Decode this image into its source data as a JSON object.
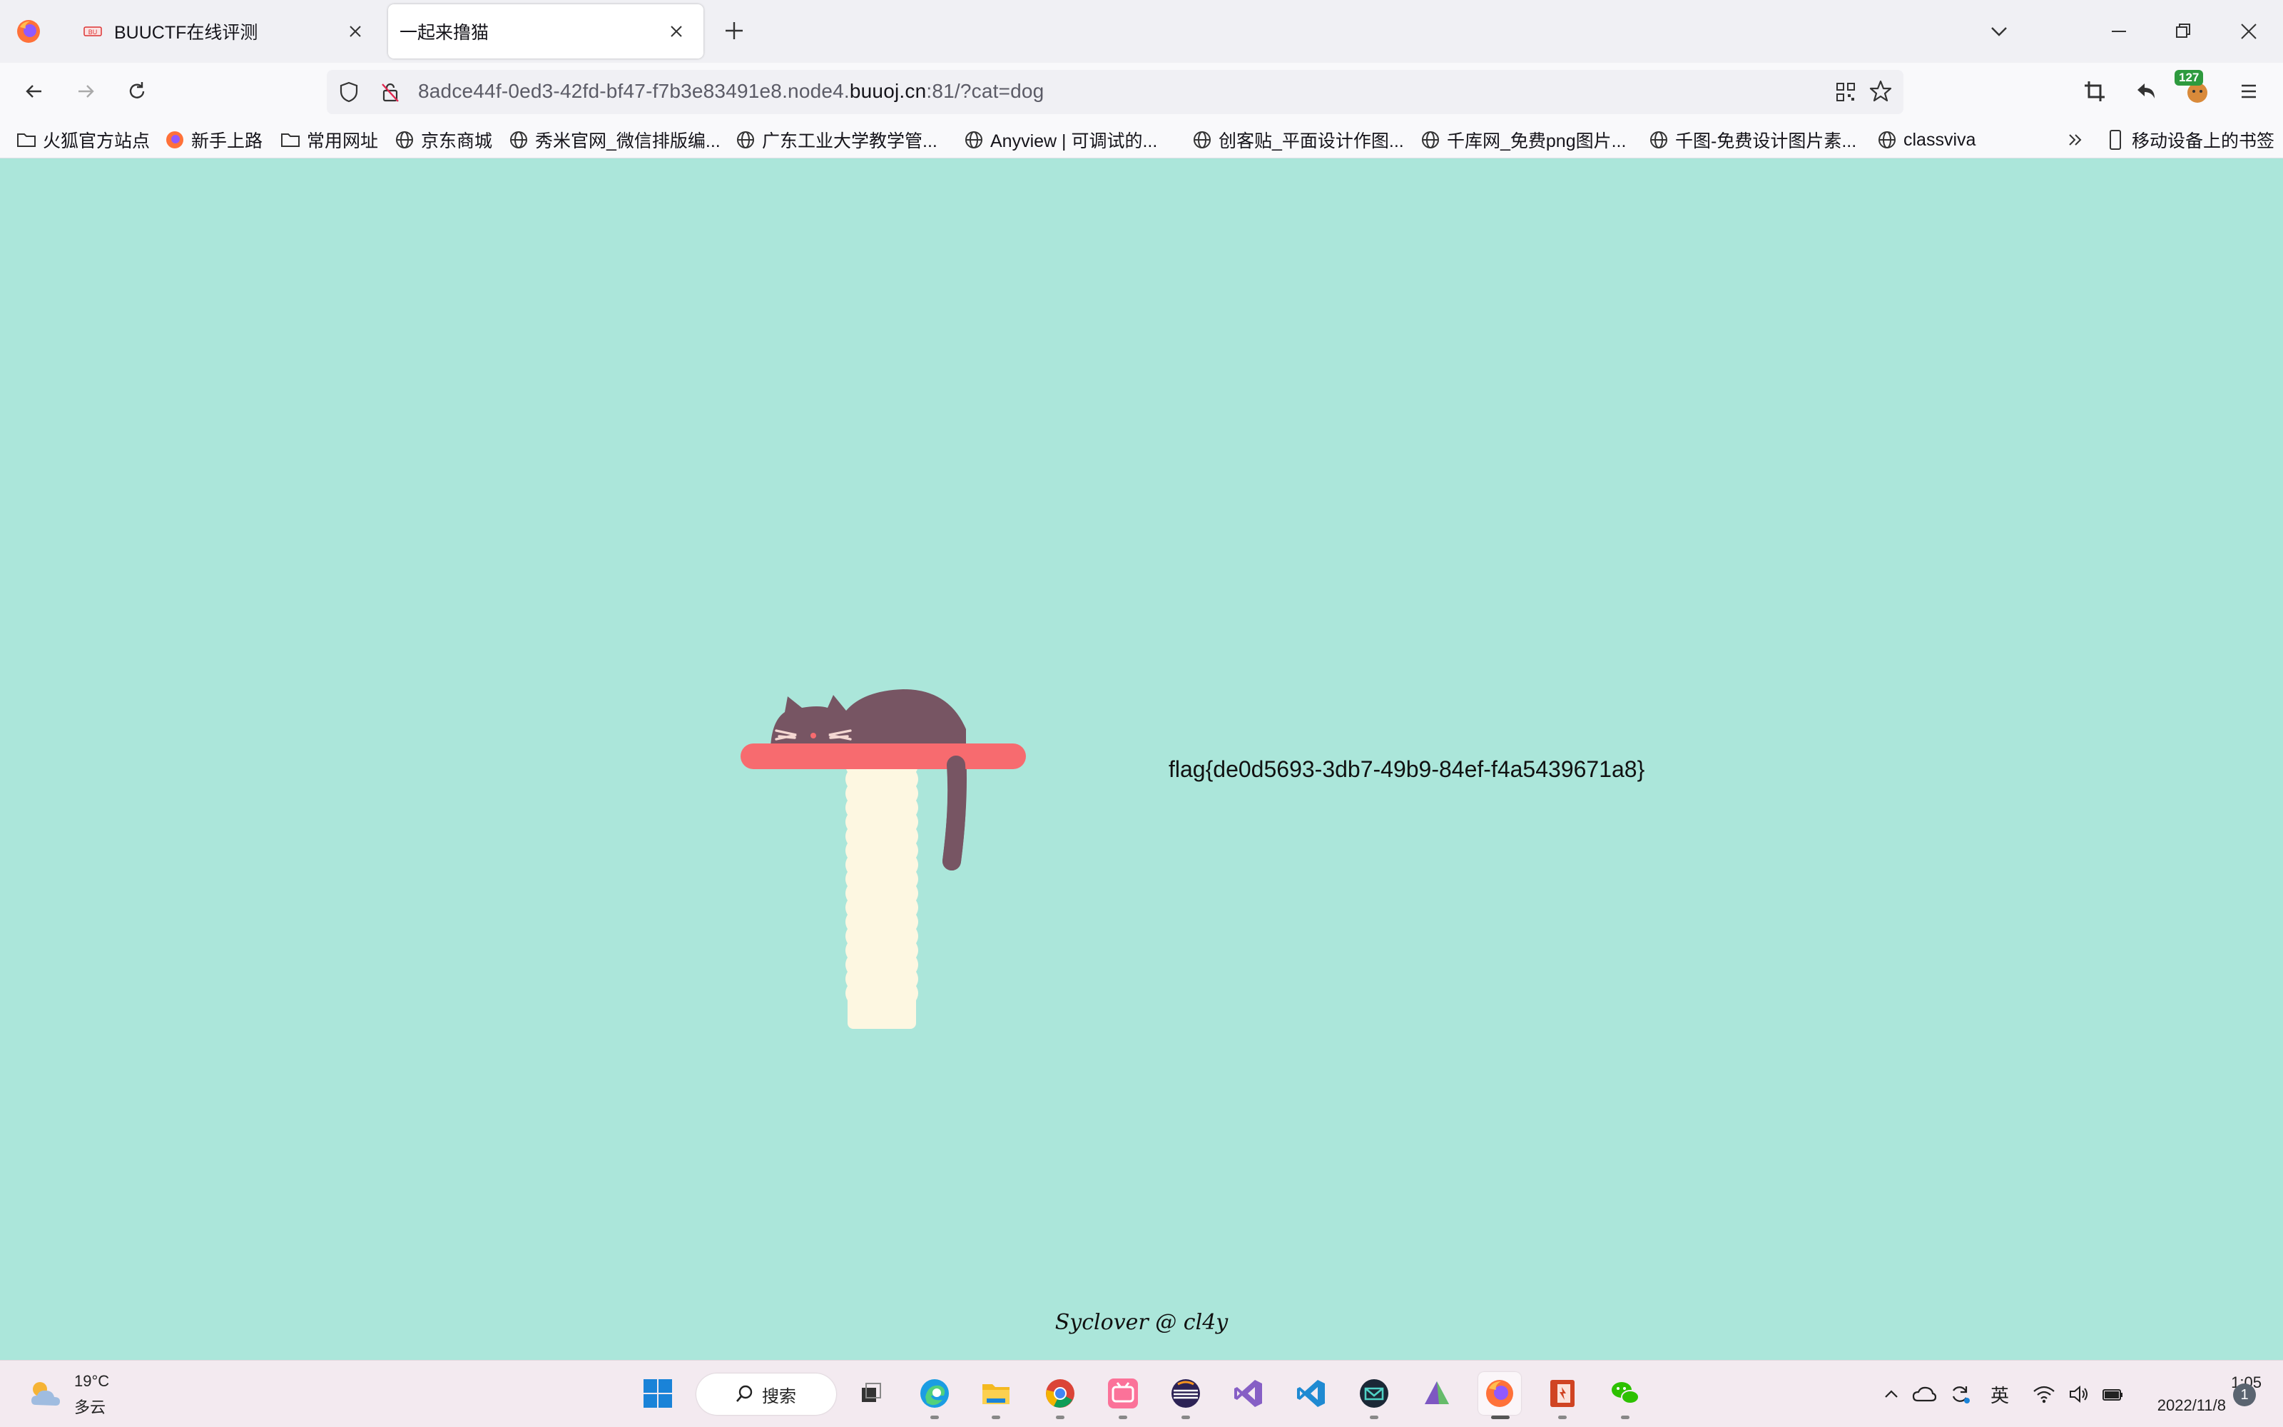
{
  "browser": {
    "tabs": [
      {
        "title": "BUUCTF在线评测",
        "active": false
      },
      {
        "title": "一起来撸猫",
        "active": true
      }
    ],
    "url": {
      "prefix": "8adce44f-0ed3-42fd-bf47-f7b3e83491e8.node4.",
      "host": "buuoj.cn",
      "suffix": ":81/?cat=dog"
    },
    "extension_badge": "127",
    "bookmarks": [
      {
        "label": "火狐官方站点",
        "icon": "folder-icon"
      },
      {
        "label": "新手上路",
        "icon": "firefox-icon"
      },
      {
        "label": "常用网址",
        "icon": "folder-icon"
      },
      {
        "label": "京东商城",
        "icon": "globe-icon"
      },
      {
        "label": "秀米官网_微信排版编...",
        "icon": "globe-icon"
      },
      {
        "label": "广东工业大学教学管...",
        "icon": "globe-icon"
      },
      {
        "label": "Anyview | 可调试的...",
        "icon": "globe-icon"
      },
      {
        "label": "创客贴_平面设计作图...",
        "icon": "globe-icon"
      },
      {
        "label": "千库网_免费png图片...",
        "icon": "globe-icon"
      },
      {
        "label": "千图-免费设计图片素...",
        "icon": "globe-icon"
      },
      {
        "label": "classviva",
        "icon": "globe-icon"
      }
    ],
    "mobile_bookmarks": "移动设备上的书签"
  },
  "page": {
    "flag": "flag{de0d5693-3db7-49b9-84ef-f4a5439671a8}",
    "footer": "Syclover @ cl4y",
    "colors": {
      "background": "#abe6da",
      "cat": "#775563",
      "shelf": "#f76b6f",
      "post": "#fdf7e1"
    }
  },
  "taskbar": {
    "weather": {
      "temp": "19°C",
      "desc": "多云"
    },
    "search_label": "搜索",
    "apps": [
      "start-icon",
      "search",
      "task-view-icon",
      "edge-icon",
      "explorer-icon",
      "chrome-icon",
      "bilibili-icon",
      "eclipse-icon",
      "visual-studio-icon",
      "vscode-icon",
      "mail-icon",
      "feather-icon",
      "firefox-icon",
      "office-icon",
      "wechat-icon"
    ],
    "ime": "英",
    "time": "1:05",
    "date": "2022/11/8",
    "notifications": "1"
  }
}
